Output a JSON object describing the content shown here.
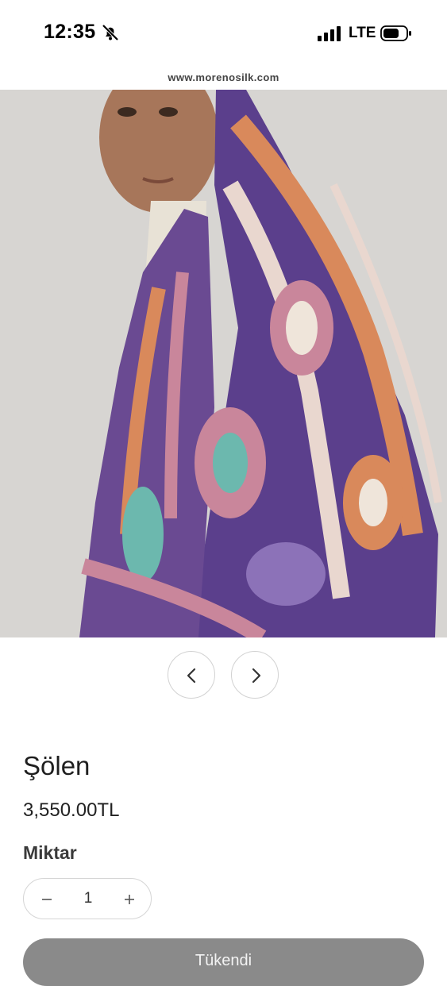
{
  "status_bar": {
    "time": "12:35",
    "network": "LTE",
    "icons": [
      "bell-slash-icon",
      "signal-icon",
      "battery-icon"
    ]
  },
  "browser": {
    "url": "www.morenosilk.com"
  },
  "product": {
    "name": "Şölen",
    "price": "3,550.00TL",
    "quantity_label": "Miktar",
    "quantity": "1",
    "sold_out_label": "Tükendi",
    "image_alt": "Silk scarf with purple paisley pattern"
  },
  "carousel": {
    "prev_icon": "chevron-left-icon",
    "next_icon": "chevron-right-icon"
  },
  "colors": {
    "button_disabled": "#8a8a8a",
    "scarf_purple": "#5b3f8c",
    "scarf_orange": "#d9895b",
    "scarf_pink": "#c9869b",
    "background": "#d6d4d1"
  }
}
